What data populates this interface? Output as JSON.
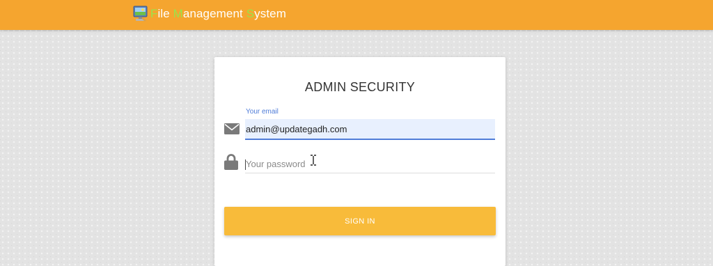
{
  "header": {
    "brand_words": [
      {
        "first": "F",
        "rest": "ile "
      },
      {
        "first": "M",
        "rest": "anagement "
      },
      {
        "first": "S",
        "rest": "ystem"
      }
    ],
    "logo_icon": "computer-monitor-icon",
    "bar_color": "#f5a52f",
    "initial_color": "#9be34a"
  },
  "login": {
    "title": "ADMIN SECURITY",
    "email_label": "Your email",
    "email_value": "admin@updategadh.com",
    "email_icon": "envelope-icon",
    "password_placeholder": "Your password",
    "password_icon": "lock-icon",
    "signin_label": "SIGN IN",
    "signin_color": "#f8bb3a",
    "focus_color": "#4f7cd8"
  }
}
